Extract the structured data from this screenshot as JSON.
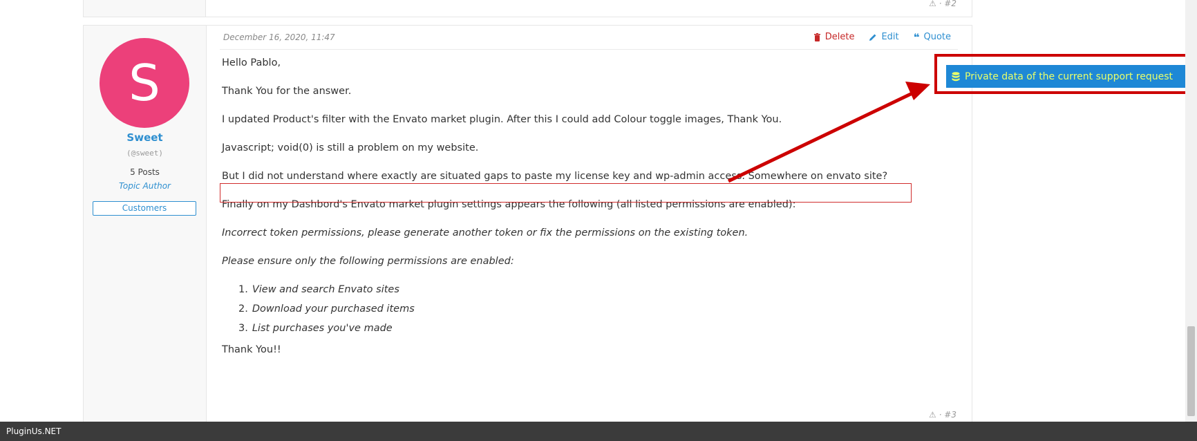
{
  "previous_post": {
    "meta": "· #2"
  },
  "post": {
    "author": {
      "avatar_letter": "S",
      "name": "Sweet",
      "handle": "(@sweet)",
      "posts": "5 Posts",
      "role": "Topic Author",
      "group": "Customers"
    },
    "date": "December 16, 2020, 11:47",
    "actions": {
      "delete": "Delete",
      "edit": "Edit",
      "quote": "Quote"
    },
    "body": {
      "p1": "Hello Pablo,",
      "p2": "Thank You for the answer.",
      "p3": "I updated Product's filter with the Envato market plugin. After this I could add Colour toggle images, Thank You.",
      "p4": "Javascript; void(0) is still a problem on my website.",
      "p5": "But I did not understand where exactly are situated gaps to paste my license key and wp-admin access. Somewhere on envato site?",
      "p6": "Finally on my Dashbord's Envato market plugin settings appears the following (all listed permissions are enabled):",
      "p7": "Incorrect token permissions, please generate another token or fix the permissions on the existing token.",
      "p8": "Please ensure only the following permissions are enabled:",
      "list": [
        {
          "num": "1.",
          "text": "View and search Envato sites"
        },
        {
          "num": "2.",
          "text": "Download your purchased items"
        },
        {
          "num": "3.",
          "text": "List purchases you've made"
        }
      ],
      "p9": "Thank You!!"
    },
    "footer_meta": "· #3"
  },
  "private_data_button": "Private data of the current support request",
  "bottom_bar": "PluginUs.NET",
  "colors": {
    "avatar": "#ec407a",
    "link": "#2e8fd0",
    "delete": "#c62828",
    "annotation": "#cc0000",
    "button_bg": "#1e88d6",
    "button_text": "#e8ff6b"
  }
}
